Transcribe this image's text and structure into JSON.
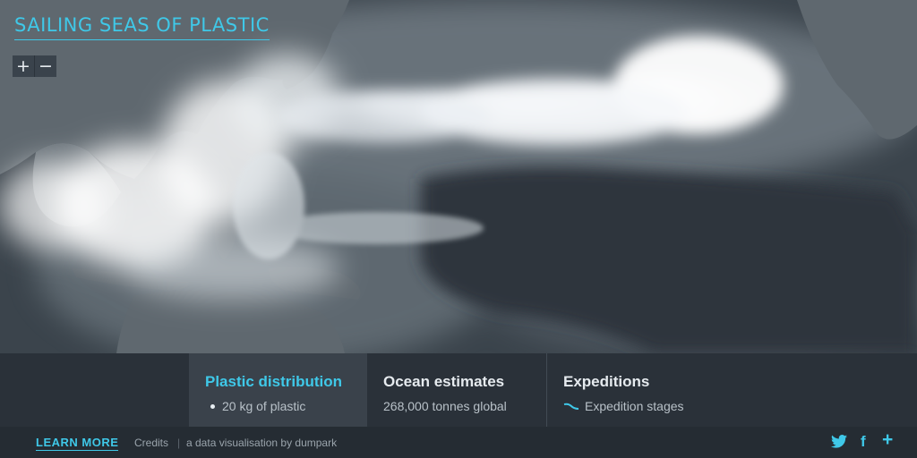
{
  "app": {
    "title": "SAILING SEAS OF PLASTIC"
  },
  "map_controls": {
    "zoom_in": "+",
    "zoom_out": "−"
  },
  "tabs": [
    {
      "title": "Plastic distribution",
      "subtitle": "20 kg of plastic",
      "active": true
    },
    {
      "title": "Ocean estimates",
      "subtitle": "268,000 tonnes global",
      "active": false
    },
    {
      "title": "Expeditions",
      "subtitle": "Expedition stages",
      "active": false
    }
  ],
  "footer": {
    "learn_more": "LEARN MORE",
    "credits": "Credits",
    "separator": "|",
    "byline": "a data visualisation by dumpark"
  },
  "social": {
    "twitter_icon": "twitter-icon",
    "facebook_icon": "facebook-icon",
    "share_icon": "plus-icon",
    "facebook_glyph": "f",
    "share_glyph": "+"
  },
  "colors": {
    "accent": "#3fc8e8",
    "ocean": "#2e363f",
    "land": "#5f686f",
    "plastic": "#ffffff",
    "panel": "#2a3139",
    "panel_active": "#3a424b",
    "footer": "#252c33"
  }
}
